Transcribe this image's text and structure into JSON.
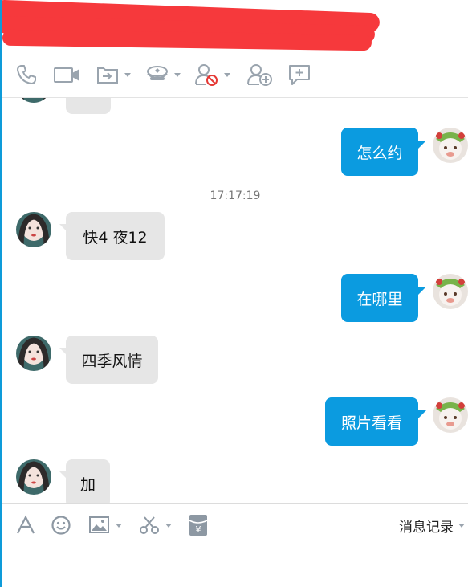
{
  "toolbar": {
    "icons": [
      "phone-icon",
      "video-icon",
      "share-screen-icon",
      "badge-icon",
      "block-user-icon",
      "add-user-icon",
      "new-chat-icon"
    ]
  },
  "chat": {
    "messages": [
      {
        "side": "out",
        "text": "怎么约"
      },
      {
        "side": "in",
        "text": "快4 夜12"
      },
      {
        "side": "out",
        "text": "在哪里"
      },
      {
        "side": "in",
        "text": "四季风情"
      },
      {
        "side": "out",
        "text": "照片看看"
      },
      {
        "side": "in",
        "text": "加"
      }
    ],
    "timestamp": "17:17:19"
  },
  "input_toolbar": {
    "history_label": "消息记录",
    "icons": [
      "font-icon",
      "emoji-icon",
      "image-icon",
      "scissors-icon",
      "red-packet-icon"
    ]
  },
  "colors": {
    "accent": "#0b9be0",
    "incoming_bubble": "#e6e6e6",
    "redaction": "#f6393c"
  }
}
